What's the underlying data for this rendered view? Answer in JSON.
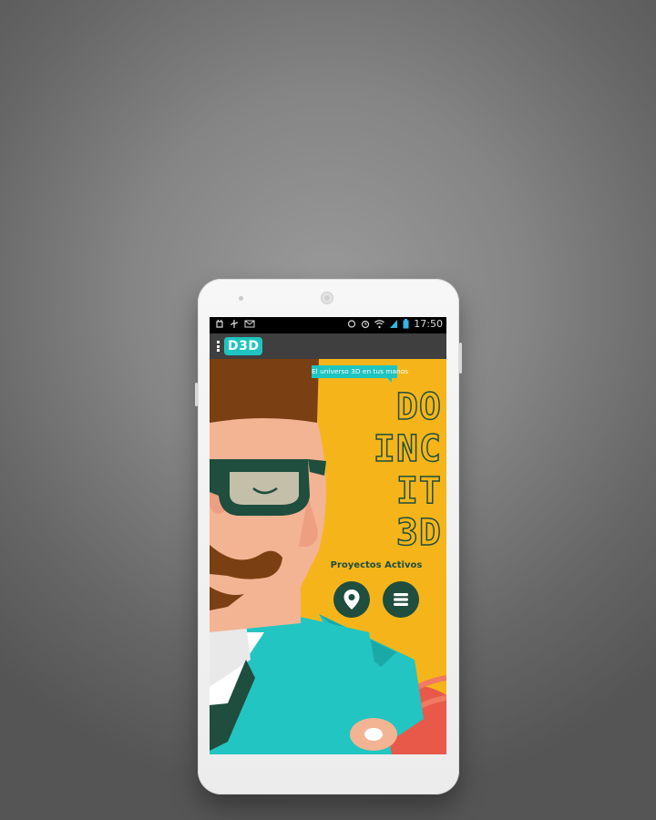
{
  "statusbar": {
    "time": "17:50",
    "left_icons": [
      "android-debug-icon",
      "usb-icon",
      "mail-icon"
    ],
    "right_icons": [
      "sync-icon",
      "alarm-icon",
      "wifi-icon",
      "signal-icon",
      "battery-charging-icon"
    ]
  },
  "appbar": {
    "logo": "D3D",
    "menu_icon": "overflow-menu-icon"
  },
  "hero": {
    "tagline": "El universo 3D en tus manos",
    "title_lines": [
      "DO",
      "INC",
      "IT",
      "3D"
    ],
    "subtitle": "Proyectos Activos"
  },
  "actions": {
    "location_icon": "location-pin-icon",
    "list_icon": "list-menu-icon"
  },
  "colors": {
    "background_yellow": "#f5b51a",
    "dark_green": "#1f4d3e",
    "teal": "#1ec4c0",
    "skin": "#f2b493",
    "hair": "#7a3f12",
    "coral": "#e8594a"
  }
}
